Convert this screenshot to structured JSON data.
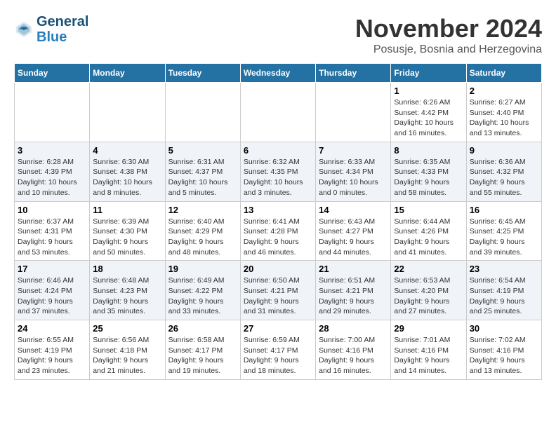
{
  "logo": {
    "line1": "General",
    "line2": "Blue"
  },
  "title": "November 2024",
  "location": "Posusje, Bosnia and Herzegovina",
  "weekdays": [
    "Sunday",
    "Monday",
    "Tuesday",
    "Wednesday",
    "Thursday",
    "Friday",
    "Saturday"
  ],
  "weeks": [
    [
      {
        "day": "",
        "info": ""
      },
      {
        "day": "",
        "info": ""
      },
      {
        "day": "",
        "info": ""
      },
      {
        "day": "",
        "info": ""
      },
      {
        "day": "",
        "info": ""
      },
      {
        "day": "1",
        "info": "Sunrise: 6:26 AM\nSunset: 4:42 PM\nDaylight: 10 hours and 16 minutes."
      },
      {
        "day": "2",
        "info": "Sunrise: 6:27 AM\nSunset: 4:40 PM\nDaylight: 10 hours and 13 minutes."
      }
    ],
    [
      {
        "day": "3",
        "info": "Sunrise: 6:28 AM\nSunset: 4:39 PM\nDaylight: 10 hours and 10 minutes."
      },
      {
        "day": "4",
        "info": "Sunrise: 6:30 AM\nSunset: 4:38 PM\nDaylight: 10 hours and 8 minutes."
      },
      {
        "day": "5",
        "info": "Sunrise: 6:31 AM\nSunset: 4:37 PM\nDaylight: 10 hours and 5 minutes."
      },
      {
        "day": "6",
        "info": "Sunrise: 6:32 AM\nSunset: 4:35 PM\nDaylight: 10 hours and 3 minutes."
      },
      {
        "day": "7",
        "info": "Sunrise: 6:33 AM\nSunset: 4:34 PM\nDaylight: 10 hours and 0 minutes."
      },
      {
        "day": "8",
        "info": "Sunrise: 6:35 AM\nSunset: 4:33 PM\nDaylight: 9 hours and 58 minutes."
      },
      {
        "day": "9",
        "info": "Sunrise: 6:36 AM\nSunset: 4:32 PM\nDaylight: 9 hours and 55 minutes."
      }
    ],
    [
      {
        "day": "10",
        "info": "Sunrise: 6:37 AM\nSunset: 4:31 PM\nDaylight: 9 hours and 53 minutes."
      },
      {
        "day": "11",
        "info": "Sunrise: 6:39 AM\nSunset: 4:30 PM\nDaylight: 9 hours and 50 minutes."
      },
      {
        "day": "12",
        "info": "Sunrise: 6:40 AM\nSunset: 4:29 PM\nDaylight: 9 hours and 48 minutes."
      },
      {
        "day": "13",
        "info": "Sunrise: 6:41 AM\nSunset: 4:28 PM\nDaylight: 9 hours and 46 minutes."
      },
      {
        "day": "14",
        "info": "Sunrise: 6:43 AM\nSunset: 4:27 PM\nDaylight: 9 hours and 44 minutes."
      },
      {
        "day": "15",
        "info": "Sunrise: 6:44 AM\nSunset: 4:26 PM\nDaylight: 9 hours and 41 minutes."
      },
      {
        "day": "16",
        "info": "Sunrise: 6:45 AM\nSunset: 4:25 PM\nDaylight: 9 hours and 39 minutes."
      }
    ],
    [
      {
        "day": "17",
        "info": "Sunrise: 6:46 AM\nSunset: 4:24 PM\nDaylight: 9 hours and 37 minutes."
      },
      {
        "day": "18",
        "info": "Sunrise: 6:48 AM\nSunset: 4:23 PM\nDaylight: 9 hours and 35 minutes."
      },
      {
        "day": "19",
        "info": "Sunrise: 6:49 AM\nSunset: 4:22 PM\nDaylight: 9 hours and 33 minutes."
      },
      {
        "day": "20",
        "info": "Sunrise: 6:50 AM\nSunset: 4:21 PM\nDaylight: 9 hours and 31 minutes."
      },
      {
        "day": "21",
        "info": "Sunrise: 6:51 AM\nSunset: 4:21 PM\nDaylight: 9 hours and 29 minutes."
      },
      {
        "day": "22",
        "info": "Sunrise: 6:53 AM\nSunset: 4:20 PM\nDaylight: 9 hours and 27 minutes."
      },
      {
        "day": "23",
        "info": "Sunrise: 6:54 AM\nSunset: 4:19 PM\nDaylight: 9 hours and 25 minutes."
      }
    ],
    [
      {
        "day": "24",
        "info": "Sunrise: 6:55 AM\nSunset: 4:19 PM\nDaylight: 9 hours and 23 minutes."
      },
      {
        "day": "25",
        "info": "Sunrise: 6:56 AM\nSunset: 4:18 PM\nDaylight: 9 hours and 21 minutes."
      },
      {
        "day": "26",
        "info": "Sunrise: 6:58 AM\nSunset: 4:17 PM\nDaylight: 9 hours and 19 minutes."
      },
      {
        "day": "27",
        "info": "Sunrise: 6:59 AM\nSunset: 4:17 PM\nDaylight: 9 hours and 18 minutes."
      },
      {
        "day": "28",
        "info": "Sunrise: 7:00 AM\nSunset: 4:16 PM\nDaylight: 9 hours and 16 minutes."
      },
      {
        "day": "29",
        "info": "Sunrise: 7:01 AM\nSunset: 4:16 PM\nDaylight: 9 hours and 14 minutes."
      },
      {
        "day": "30",
        "info": "Sunrise: 7:02 AM\nSunset: 4:16 PM\nDaylight: 9 hours and 13 minutes."
      }
    ]
  ]
}
